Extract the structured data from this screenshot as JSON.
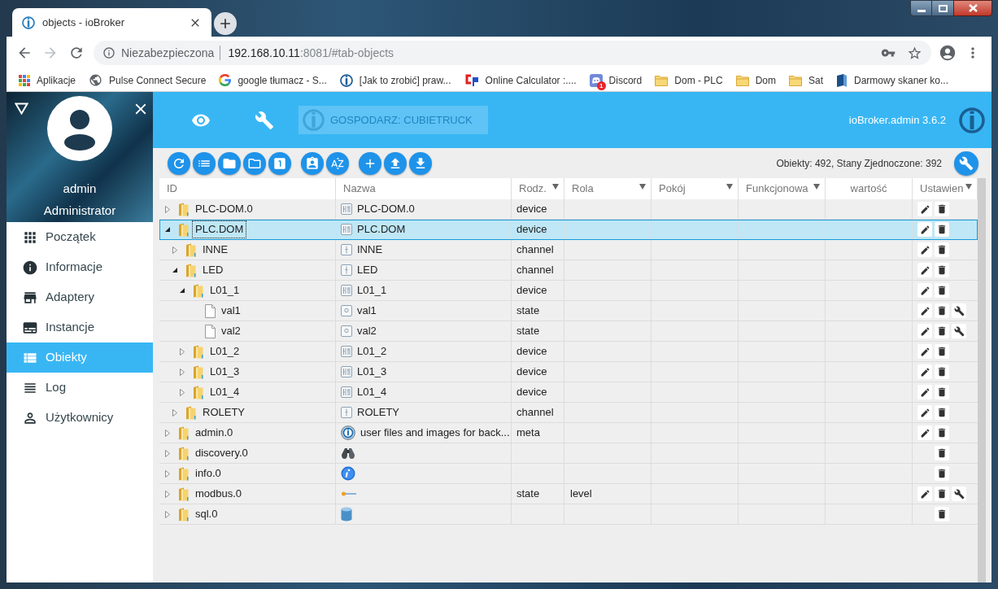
{
  "browser": {
    "tab": {
      "title": "objects - ioBroker"
    },
    "address": {
      "security": "Niezabezpieczona",
      "host": "192.168.10.11",
      "path": ":8081/#tab-objects"
    },
    "bookmarks": [
      {
        "label": "Aplikacje",
        "kind": "apps"
      },
      {
        "label": "Pulse Connect Secure",
        "kind": "globe"
      },
      {
        "label": "google tłumacz - S...",
        "kind": "google"
      },
      {
        "label": "[Jak to zrobić] praw...",
        "kind": "logo"
      },
      {
        "label": "Online Calculator :....",
        "kind": "calculator"
      },
      {
        "label": "Discord",
        "kind": "chat",
        "badge": "1"
      },
      {
        "label": "Dom - PLC",
        "kind": "folder"
      },
      {
        "label": "Dom",
        "kind": "folder"
      },
      {
        "label": "Sat",
        "kind": "folder"
      },
      {
        "label": "Darmowy skaner ko...",
        "kind": "scanner"
      }
    ]
  },
  "sidebar": {
    "user": {
      "name": "admin",
      "role": "Administrator"
    },
    "items": [
      {
        "label": "Początek",
        "kind": "apps",
        "selected": false
      },
      {
        "label": "Informacje",
        "kind": "info",
        "selected": false
      },
      {
        "label": "Adaptery",
        "kind": "store",
        "selected": false
      },
      {
        "label": "Instancje",
        "kind": "instances",
        "selected": false
      },
      {
        "label": "Obiekty",
        "kind": "objects",
        "selected": true
      },
      {
        "label": "Log",
        "kind": "log",
        "selected": false
      },
      {
        "label": "Użytkownicy",
        "kind": "users",
        "selected": false
      }
    ]
  },
  "header": {
    "host": "GOSPODARZ: CUBIETRUCK",
    "version": "ioBroker.admin 3.6.2"
  },
  "toolbar": {
    "stats": "Obiekty: 492, Stany Zjednoczone: 392"
  },
  "table": {
    "columns": [
      {
        "label": "ID",
        "filter": false
      },
      {
        "label": "Nazwa",
        "filter": false
      },
      {
        "label": "Rodz.",
        "filter": true
      },
      {
        "label": "Rola",
        "filter": true
      },
      {
        "label": "Pokój",
        "filter": true
      },
      {
        "label": "Funkcjonowa",
        "filter": true
      },
      {
        "label": "wartość",
        "filter": false
      },
      {
        "label": "Ustawien",
        "filter": true
      }
    ],
    "rows": [
      {
        "id": "PLC-DOM.0",
        "kind": "folder",
        "expanded": false,
        "selected": false,
        "name": {
          "kind": "grid",
          "text": "PLC-DOM.0"
        },
        "type": "device",
        "edit": true,
        "settings": false
      },
      {
        "id": "PLC.DOM",
        "kind": "folder",
        "expanded": true,
        "selected": true,
        "name": {
          "kind": "grid",
          "text": "PLC.DOM"
        },
        "type": "device",
        "edit": true,
        "settings": false,
        "children": [
          {
            "id": "INNE",
            "kind": "folder",
            "expanded": false,
            "selected": false,
            "name": {
              "kind": "bar",
              "text": "INNE"
            },
            "type": "channel",
            "edit": true,
            "settings": false
          },
          {
            "id": "LED",
            "kind": "folder",
            "expanded": true,
            "selected": false,
            "name": {
              "kind": "bar",
              "text": "LED"
            },
            "type": "channel",
            "edit": true,
            "settings": false,
            "children": [
              {
                "id": "L01_1",
                "kind": "folder",
                "expanded": true,
                "selected": false,
                "name": {
                  "kind": "grid",
                  "text": "L01_1"
                },
                "type": "device",
                "edit": true,
                "settings": false,
                "children": [
                  {
                    "id": "val1",
                    "kind": "file",
                    "selected": false,
                    "name": {
                      "kind": "dot",
                      "text": "val1"
                    },
                    "type": "state",
                    "edit": true,
                    "settings": true
                  },
                  {
                    "id": "val2",
                    "kind": "file",
                    "selected": false,
                    "name": {
                      "kind": "dot",
                      "text": "val2"
                    },
                    "type": "state",
                    "edit": true,
                    "settings": true
                  }
                ]
              },
              {
                "id": "L01_2",
                "kind": "folder",
                "expanded": false,
                "selected": false,
                "name": {
                  "kind": "grid",
                  "text": "L01_2"
                },
                "type": "device",
                "edit": true,
                "settings": false
              },
              {
                "id": "L01_3",
                "kind": "folder",
                "expanded": false,
                "selected": false,
                "name": {
                  "kind": "grid",
                  "text": "L01_3"
                },
                "type": "device",
                "edit": true,
                "settings": false
              },
              {
                "id": "L01_4",
                "kind": "folder",
                "expanded": false,
                "selected": false,
                "name": {
                  "kind": "grid",
                  "text": "L01_4"
                },
                "type": "device",
                "edit": true,
                "settings": false
              }
            ]
          },
          {
            "id": "ROLETY",
            "kind": "folder",
            "expanded": false,
            "selected": false,
            "name": {
              "kind": "bar",
              "text": "ROLETY"
            },
            "type": "channel",
            "edit": true,
            "settings": false
          }
        ]
      },
      {
        "id": "admin.0",
        "kind": "folder",
        "expanded": false,
        "selected": false,
        "name": {
          "kind": "logo",
          "text": "user files and images for back..."
        },
        "type": "meta",
        "edit": true,
        "settings": false
      },
      {
        "id": "discovery.0",
        "kind": "folder",
        "expanded": false,
        "selected": false,
        "name": {
          "kind": "binoculars"
        },
        "edit": false,
        "settings": false
      },
      {
        "id": "info.0",
        "kind": "folder",
        "expanded": false,
        "selected": false,
        "name": {
          "kind": "info"
        },
        "edit": false,
        "settings": false
      },
      {
        "id": "modbus.0",
        "kind": "folder",
        "expanded": false,
        "selected": false,
        "name": {
          "kind": "connector"
        },
        "type": "state",
        "role": "level",
        "edit": true,
        "settings": true
      },
      {
        "id": "sql.0",
        "kind": "folder",
        "expanded": false,
        "selected": false,
        "name": {
          "kind": "database"
        },
        "edit": false,
        "settings": false
      }
    ]
  }
}
